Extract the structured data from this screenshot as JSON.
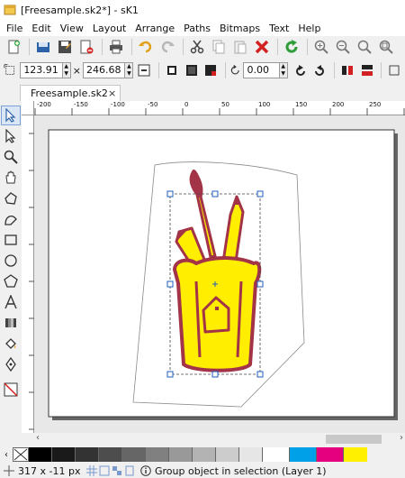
{
  "window": {
    "title": "[Freesample.sk2*] - sK1"
  },
  "menu": [
    "File",
    "Edit",
    "View",
    "Layout",
    "Arrange",
    "Paths",
    "Bitmaps",
    "Text",
    "Help"
  ],
  "toolbar": {
    "icons": [
      "new-icon",
      "open-icon",
      "save-icon",
      "save-as-icon",
      "close-doc-icon",
      "print-icon",
      "undo-icon",
      "redo-icon",
      "cut-icon",
      "copy-icon",
      "paste-icon",
      "delete-icon",
      "refresh-icon",
      "zoom-in-icon",
      "zoom-out-icon",
      "zoom-fit-icon",
      "zoom-page-icon"
    ]
  },
  "propbar": {
    "width_value": "123.91",
    "height_value": "246.68",
    "rotation_value": "0.00"
  },
  "tab": {
    "label": "Freesample.sk2",
    "close": "×"
  },
  "ruler": {
    "ticks": [
      "-200",
      "-150",
      "-100",
      "-50",
      "0",
      "50",
      "100",
      "150",
      "200",
      "250"
    ]
  },
  "status": {
    "coords": "317 x -11 px",
    "message": "Group object in selection (Layer 1)"
  },
  "palette_colors": [
    "#000000",
    "#1a1a1a",
    "#333333",
    "#4d4d4d",
    "#666666",
    "#808080",
    "#999999",
    "#b3b3b3",
    "#cccccc",
    "#e6e6e6",
    "#ffffff",
    "#ffffff",
    "#00a0e9",
    "#e4007f",
    "#fff000"
  ],
  "drawing": {
    "fill": "#ffee00",
    "stroke": "#a33448"
  }
}
